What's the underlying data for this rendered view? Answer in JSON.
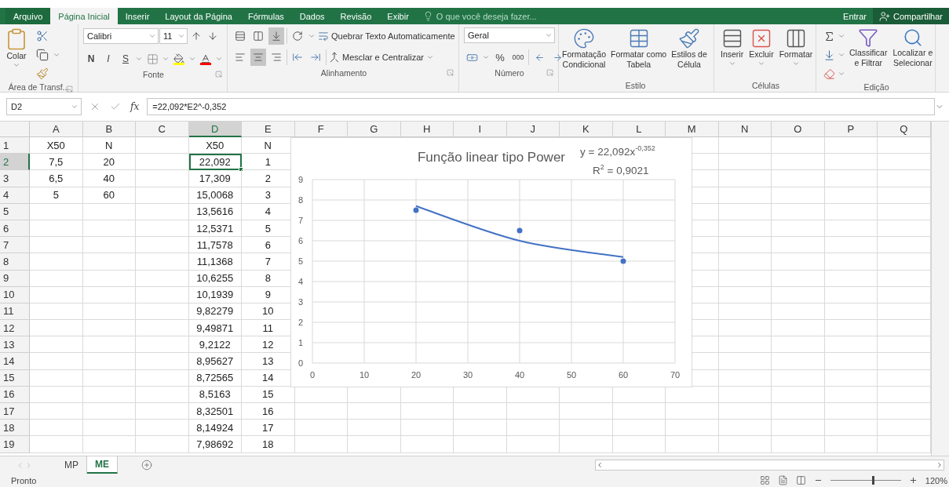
{
  "tabs": [
    {
      "label": "Arquivo",
      "kind": "file",
      "selected": false
    },
    {
      "label": "Página Inicial",
      "kind": "tab",
      "selected": true
    },
    {
      "label": "Inserir",
      "kind": "tab",
      "selected": false
    },
    {
      "label": "Layout da Página",
      "kind": "tab",
      "selected": false
    },
    {
      "label": "Fórmulas",
      "kind": "tab",
      "selected": false
    },
    {
      "label": "Dados",
      "kind": "tab",
      "selected": false
    },
    {
      "label": "Revisão",
      "kind": "tab",
      "selected": false
    },
    {
      "label": "Exibir",
      "kind": "tab",
      "selected": false
    }
  ],
  "tell_me": {
    "placeholder": "O que você deseja fazer..."
  },
  "account": {
    "sign_in": "Entrar",
    "share": "Compartilhar"
  },
  "ribbon": {
    "clipboard": {
      "label": "Área de Transf...",
      "paste": "Colar"
    },
    "font": {
      "label": "Fonte",
      "name": "Calibri",
      "size": "11",
      "styles": [
        "N",
        "I",
        "S"
      ]
    },
    "alignment": {
      "label": "Alinhamento",
      "wrap": "Quebrar Texto Automaticamente",
      "merge": "Mesclar e Centralizar",
      "vertical": [
        {
          "selected": false
        },
        {
          "selected": false
        },
        {
          "selected": true
        }
      ],
      "horizontal": [
        {
          "selected": false
        },
        {
          "selected": true
        },
        {
          "selected": false
        }
      ]
    },
    "number": {
      "label": "Número",
      "format": "Geral",
      "percent": "%",
      "thousands": "000"
    },
    "styles": {
      "label": "Estilo",
      "buttons": [
        {
          "lines": [
            "Formatação",
            "Condicional"
          ]
        },
        {
          "lines": [
            "Formatar como",
            "Tabela"
          ]
        },
        {
          "lines": [
            "Estilos de",
            "Célula"
          ]
        }
      ]
    },
    "cells": {
      "label": "Células",
      "buttons": [
        {
          "lines": [
            "Inserir"
          ]
        },
        {
          "lines": [
            "Excluir"
          ]
        },
        {
          "lines": [
            "Formatar"
          ]
        }
      ]
    },
    "editing": {
      "label": "Edição",
      "buttons": [
        {
          "lines": [
            "Classificar",
            "e Filtrar"
          ]
        },
        {
          "lines": [
            "Localizar e",
            "Selecionar"
          ]
        }
      ]
    }
  },
  "formula_bar": {
    "name_box": "D2",
    "fx": "fx",
    "formula": "=22,092*E2^-0,352"
  },
  "columns": [
    "A",
    "B",
    "C",
    "D",
    "E",
    "F",
    "G",
    "H",
    "I",
    "J",
    "K",
    "L",
    "M",
    "N",
    "O",
    "P",
    "Q"
  ],
  "rows": [
    {
      "number": "1",
      "cells": [
        {
          "text": "X50",
          "selected": false
        },
        {
          "text": "N",
          "selected": false
        },
        {
          "selected": false
        },
        {
          "text": "X50",
          "selected": false
        },
        {
          "text": "N",
          "selected": false
        }
      ]
    },
    {
      "number": "2",
      "cells": [
        {
          "text": "7,5",
          "selected": false
        },
        {
          "text": "20",
          "selected": false
        },
        {
          "selected": false
        },
        {
          "text": "22,092",
          "selected": true
        },
        {
          "text": "1",
          "selected": false
        }
      ]
    },
    {
      "number": "3",
      "cells": [
        {
          "text": "6,5",
          "selected": false
        },
        {
          "text": "40",
          "selected": false
        },
        {
          "selected": false
        },
        {
          "text": "17,309",
          "selected": false
        },
        {
          "text": "2",
          "selected": false
        }
      ]
    },
    {
      "number": "4",
      "cells": [
        {
          "text": "5",
          "selected": false
        },
        {
          "text": "60",
          "selected": false
        },
        {
          "selected": false
        },
        {
          "text": "15,0068",
          "selected": false
        },
        {
          "text": "3",
          "selected": false
        }
      ]
    },
    {
      "number": "5",
      "cells": [
        {
          "selected": false
        },
        {
          "selected": false
        },
        {
          "selected": false
        },
        {
          "text": "13,5616",
          "selected": false
        },
        {
          "text": "4",
          "selected": false
        }
      ]
    },
    {
      "number": "6",
      "cells": [
        {
          "selected": false
        },
        {
          "selected": false
        },
        {
          "selected": false
        },
        {
          "text": "12,5371",
          "selected": false
        },
        {
          "text": "5",
          "selected": false
        }
      ]
    },
    {
      "number": "7",
      "cells": [
        {
          "selected": false
        },
        {
          "selected": false
        },
        {
          "selected": false
        },
        {
          "text": "11,7578",
          "selected": false
        },
        {
          "text": "6",
          "selected": false
        }
      ]
    },
    {
      "number": "8",
      "cells": [
        {
          "selected": false
        },
        {
          "selected": false
        },
        {
          "selected": false
        },
        {
          "text": "11,1368",
          "selected": false
        },
        {
          "text": "7",
          "selected": false
        }
      ]
    },
    {
      "number": "9",
      "cells": [
        {
          "selected": false
        },
        {
          "selected": false
        },
        {
          "selected": false
        },
        {
          "text": "10,6255",
          "selected": false
        },
        {
          "text": "8",
          "selected": false
        }
      ]
    },
    {
      "number": "10",
      "cells": [
        {
          "selected": false
        },
        {
          "selected": false
        },
        {
          "selected": false
        },
        {
          "text": "10,1939",
          "selected": false
        },
        {
          "text": "9",
          "selected": false
        }
      ]
    },
    {
      "number": "11",
      "cells": [
        {
          "selected": false
        },
        {
          "selected": false
        },
        {
          "selected": false
        },
        {
          "text": "9,82279",
          "selected": false
        },
        {
          "text": "10",
          "selected": false
        }
      ]
    },
    {
      "number": "12",
      "cells": [
        {
          "selected": false
        },
        {
          "selected": false
        },
        {
          "selected": false
        },
        {
          "text": "9,49871",
          "selected": false
        },
        {
          "text": "11",
          "selected": false
        }
      ]
    },
    {
      "number": "13",
      "cells": [
        {
          "selected": false
        },
        {
          "selected": false
        },
        {
          "selected": false
        },
        {
          "text": "9,2122",
          "selected": false
        },
        {
          "text": "12",
          "selected": false
        }
      ]
    },
    {
      "number": "14",
      "cells": [
        {
          "selected": false
        },
        {
          "selected": false
        },
        {
          "selected": false
        },
        {
          "text": "8,95627",
          "selected": false
        },
        {
          "text": "13",
          "selected": false
        }
      ]
    },
    {
      "number": "15",
      "cells": [
        {
          "selected": false
        },
        {
          "selected": false
        },
        {
          "selected": false
        },
        {
          "text": "8,72565",
          "selected": false
        },
        {
          "text": "14",
          "selected": false
        }
      ]
    },
    {
      "number": "16",
      "cells": [
        {
          "selected": false
        },
        {
          "selected": false
        },
        {
          "selected": false
        },
        {
          "text": "8,5163",
          "selected": false
        },
        {
          "text": "15",
          "selected": false
        }
      ]
    },
    {
      "number": "17",
      "cells": [
        {
          "selected": false
        },
        {
          "selected": false
        },
        {
          "selected": false
        },
        {
          "text": "8,32501",
          "selected": false
        },
        {
          "text": "16",
          "selected": false
        }
      ]
    },
    {
      "number": "18",
      "cells": [
        {
          "selected": false
        },
        {
          "selected": false
        },
        {
          "selected": false
        },
        {
          "text": "8,14924",
          "selected": false
        },
        {
          "text": "17",
          "selected": false
        }
      ]
    },
    {
      "number": "19",
      "cells": [
        {
          "selected": false
        },
        {
          "selected": false
        },
        {
          "selected": false
        },
        {
          "text": "7,98692",
          "selected": false
        },
        {
          "text": "18",
          "selected": false
        }
      ]
    }
  ],
  "chart": {
    "chart_data": {
      "type": "scatter",
      "title": "Função linear tipo Power",
      "x": [
        20,
        40,
        60
      ],
      "grid": true,
      "series": [
        {
          "type": "scatter",
          "color": "#4472c4",
          "values": [
            7.5,
            6.5,
            5
          ]
        },
        {
          "type": "line",
          "color": "#4472c4",
          "values": [
            7.7,
            6.0,
            5.2
          ]
        }
      ],
      "xlim": [
        0,
        70
      ],
      "ylim": [
        0,
        9
      ],
      "xticks": [
        0,
        10,
        20,
        30,
        40,
        50,
        60,
        70
      ],
      "yticks": [
        0,
        1,
        2,
        3,
        4,
        5,
        6,
        7,
        8,
        9
      ],
      "annotations": [
        {
          "text": "y = 22,092x$^{-0,352}$"
        },
        {
          "text": "R$^{2}$ = 0,9021"
        }
      ]
    }
  },
  "sheet_tabs": [
    {
      "label": "MP",
      "selected": false
    },
    {
      "label": "ME",
      "selected": true
    }
  ],
  "status_bar": {
    "status": "Pronto",
    "zoom": {
      "level": 0.6,
      "reading": "120%"
    }
  }
}
